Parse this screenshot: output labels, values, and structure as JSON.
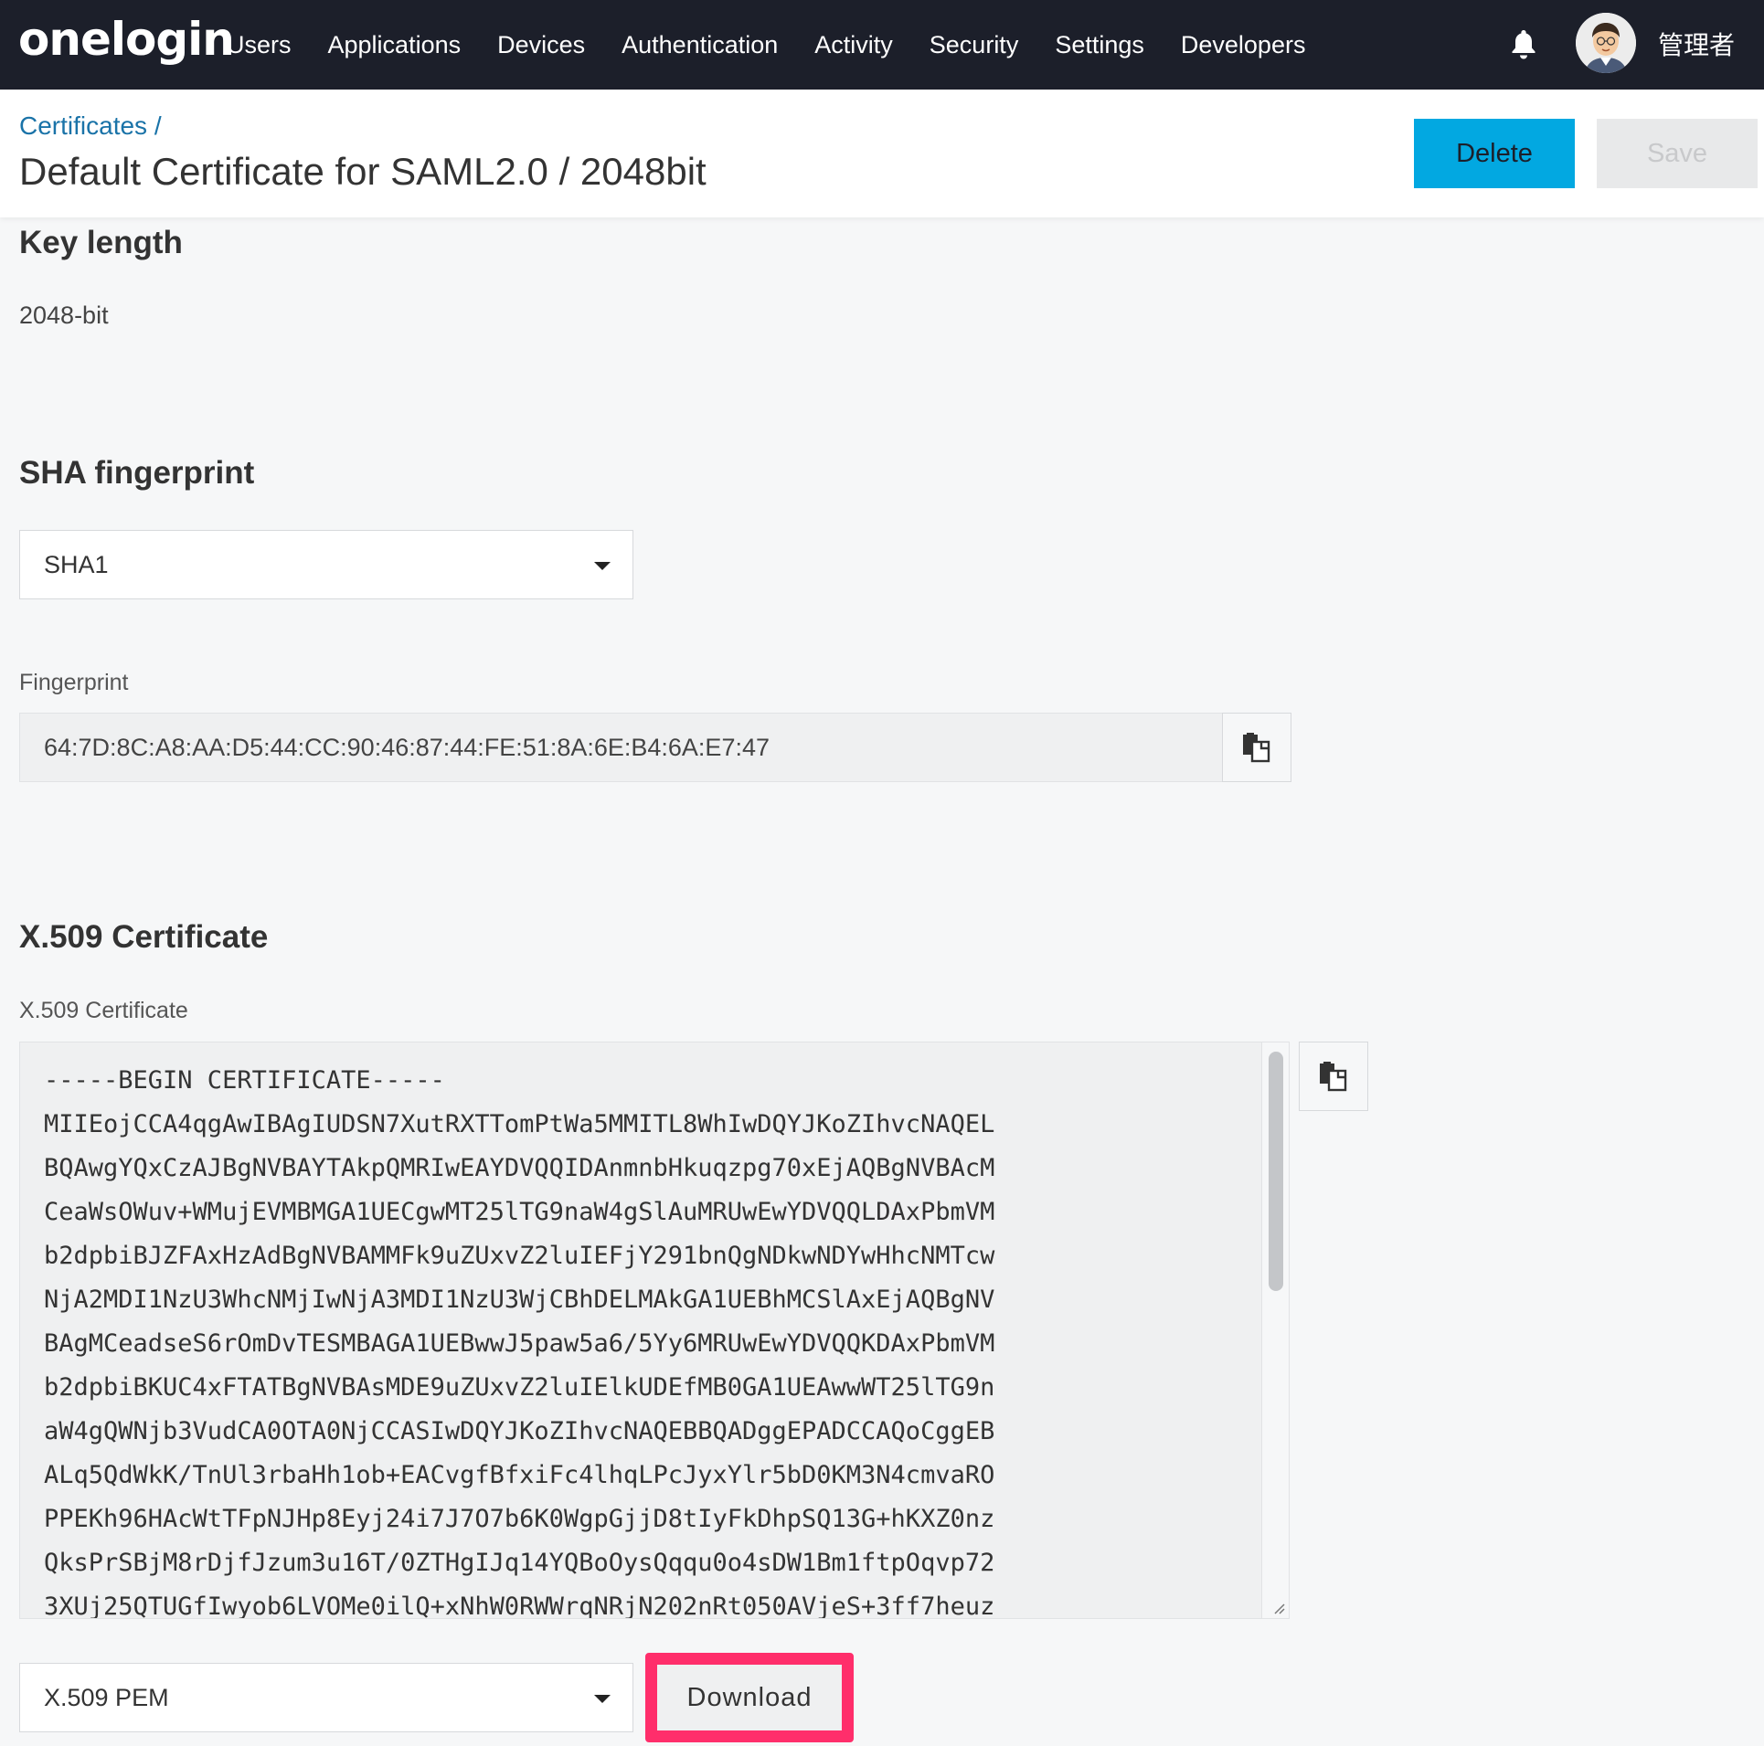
{
  "nav": {
    "logo": "onelogin",
    "links": [
      "Users",
      "Applications",
      "Devices",
      "Authentication",
      "Activity",
      "Security",
      "Settings",
      "Developers"
    ],
    "username": "管理者"
  },
  "header": {
    "breadcrumb": "Certificates /",
    "title": "Default Certificate for SAML2.0 / 2048bit",
    "delete_label": "Delete",
    "save_label": "Save"
  },
  "key_length": {
    "heading": "Key length",
    "value": "2048-bit"
  },
  "sha": {
    "heading": "SHA fingerprint",
    "selected": "SHA1",
    "fingerprint_label": "Fingerprint",
    "fingerprint_value": "64:7D:8C:A8:AA:D5:44:CC:90:46:87:44:FE:51:8A:6E:B4:6A:E7:47"
  },
  "x509": {
    "heading": "X.509 Certificate",
    "field_label": "X.509 Certificate",
    "lines": [
      "-----BEGIN CERTIFICATE-----",
      "MIIEojCCA4qgAwIBAgIUDSN7XutRXTTomPtWa5MMITL8WhIwDQYJKoZIhvcNAQEL",
      "BQAwgYQxCzAJBgNVBAYTAkpQMRIwEAYDVQQIDAnmnbHkuqzpg70xEjAQBgNVBAcM",
      "CeaWsOWuv+WMujEVMBMGA1UECgwMT25lTG9naW4gSlAuMRUwEwYDVQQLDAxPbmVM",
      "b2dpbiBJZFAxHzAdBgNVBAMMFk9uZUxvZ2luIEFjY291bnQgNDkwNDYwHhcNMTcw",
      "NjA2MDI1NzU3WhcNMjIwNjA3MDI1NzU3WjCBhDELMAkGA1UEBhMCSlAxEjAQBgNV",
      "BAgMCeadseS6rOmDvTESMBAGA1UEBwwJ5paw5a6/5Yy6MRUwEwYDVQQKDAxPbmVM",
      "b2dpbiBKUC4xFTATBgNVBAsMDE9uZUxvZ2luIElkUDEfMB0GA1UEAwwWT25lTG9n",
      "aW4gQWNjb3VudCA0OTA0NjCCASIwDQYJKoZIhvcNAQEBBQADggEPADCCAQoCggEB",
      "ALq5QdWkK/TnUl3rbaHh1ob+EACvgfBfxiFc4lhqLPcJyxYlr5bD0KM3N4cmvaRO",
      "PPEKh96HAcWtTFpNJHp8Eyj24i7J7O7b6K0WgpGjjD8tIyFkDhpSQ13G+hKXZ0nz",
      "QksPrSBjM8rDjfJzum3u16T/0ZTHgIJq14YQBoOysQqqu0o4sDW1Bm1ftpOqvp72",
      "3XUj25QTUGfIwyob6LVOMe0ilQ+xNhW0RWWrqNRjN202nRt050AVjeS+3ff7heuz"
    ],
    "format_selected": "X.509 PEM",
    "download_label": "Download"
  },
  "colors": {
    "nav_bg": "#1c1f2a",
    "accent": "#02a8e1",
    "highlight": "#ff2e6b",
    "link": "#1a73a8"
  }
}
